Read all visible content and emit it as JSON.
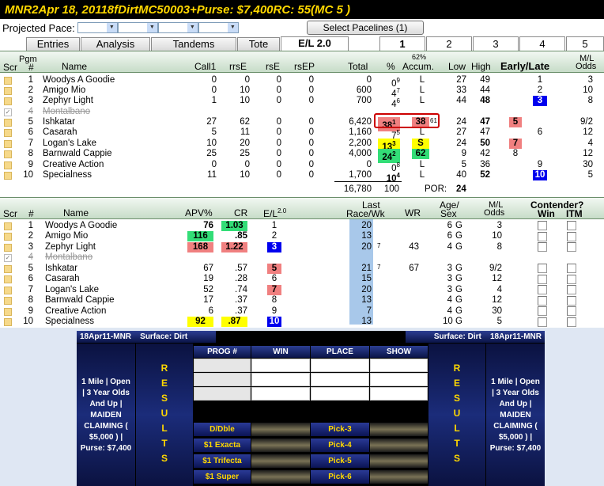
{
  "title": {
    "track": "MNR",
    "race": "2",
    "date": "Apr 18, 2011",
    "distance": "8f",
    "surface": "Dirt",
    "class": "MC5000",
    "age": "3+",
    "purse": "Purse: $7,400",
    "rc": "RC: 55",
    "mc": "(MC 5 )"
  },
  "pace": {
    "label": "Projected Pace:",
    "button": "Select Pacelines  (1)"
  },
  "tabs": [
    "Entries",
    "Analysis",
    "Tandems",
    "Tote",
    "E/L 2.0"
  ],
  "rtabs": [
    "1",
    "2",
    "3",
    "4",
    "5"
  ],
  "top_header": {
    "scr": "Scr",
    "pgm": "Pgm",
    "pgm_hash": "#",
    "name": "Name",
    "call1": "Call1",
    "rrse": "rrsE",
    "rse": "rsE",
    "rsep": "rsEP",
    "total": "Total",
    "pct": "%",
    "accum_pct": "62%",
    "accum": "Accum.",
    "low": "Low",
    "high": "High",
    "early_late": "Early/Late",
    "ml": "M/L",
    "odds": "Odds"
  },
  "top_rows": [
    {
      "num": "1",
      "name": "Woodys A Goodie",
      "call1": "0",
      "rrse": "0",
      "rse": "0",
      "rsep": "0",
      "total": "0",
      "pct": "0",
      "pct_sup": "9",
      "accum": "L",
      "low": "27",
      "high": "49",
      "early": "",
      "late": "1",
      "ml": "3"
    },
    {
      "num": "2",
      "name": "Amigo Mio",
      "call1": "0",
      "rrse": "10",
      "rse": "0",
      "rsep": "0",
      "total": "600",
      "pct": "4",
      "pct_sup": "7",
      "accum": "L",
      "low": "33",
      "high": "44",
      "early": "",
      "late": "2",
      "ml": "10"
    },
    {
      "num": "3",
      "name": "Zephyr Light",
      "call1": "1",
      "rrse": "10",
      "rse": "0",
      "rsep": "0",
      "total": "700",
      "pct": "4",
      "pct_sup": "6",
      "accum": "L",
      "low": "44",
      "high": "48",
      "early": "",
      "late": "3",
      "ml": "8"
    },
    {
      "num": "4",
      "name": "Montalbano",
      "scratched": true
    },
    {
      "num": "5",
      "name": "Ishkatar",
      "call1": "27",
      "rrse": "62",
      "rse": "0",
      "rsep": "0",
      "total": "6,420",
      "pct": "38",
      "pct_sup": "1",
      "accum": "38",
      "accum_sup": "61",
      "low": "24",
      "high": "47",
      "early": "5",
      "late": "",
      "ml": "9/2"
    },
    {
      "num": "6",
      "name": "Casarah",
      "call1": "5",
      "rrse": "11",
      "rse": "0",
      "rsep": "0",
      "total": "1,160",
      "pct": "7",
      "pct_sup": "5",
      "accum": "L",
      "low": "27",
      "high": "47",
      "early": "",
      "late": "6",
      "ml": "12"
    },
    {
      "num": "7",
      "name": "Logan's Lake",
      "call1": "10",
      "rrse": "20",
      "rse": "0",
      "rsep": "0",
      "total": "2,200",
      "pct": "13",
      "pct_sup": "3",
      "accum": "S",
      "low": "24",
      "high": "50",
      "early": "7",
      "late": "",
      "ml": "4"
    },
    {
      "num": "8",
      "name": "Barnwald Cappie",
      "call1": "25",
      "rrse": "25",
      "rse": "0",
      "rsep": "0",
      "total": "4,000",
      "pct": "24",
      "pct_sup": "2",
      "accum": "62",
      "low": "9",
      "high": "42",
      "early": "8",
      "late": "",
      "ml": "12"
    },
    {
      "num": "9",
      "name": "Creative Action",
      "call1": "0",
      "rrse": "0",
      "rse": "0",
      "rsep": "0",
      "total": "0",
      "pct": "0",
      "pct_sup": "8",
      "accum": "L",
      "low": "5",
      "high": "36",
      "early": "",
      "late": "9",
      "ml": "30"
    },
    {
      "num": "10",
      "name": "Specialness",
      "call1": "11",
      "rrse": "10",
      "rse": "0",
      "rsep": "0",
      "total": "1,700",
      "pct": "10",
      "pct_sup": "4",
      "accum": "L",
      "low": "40",
      "high": "52",
      "early": "",
      "late": "10",
      "ml": "5"
    }
  ],
  "top_totals": {
    "total": "16,780",
    "pct": "100",
    "por_label": "POR:",
    "por": "24"
  },
  "mid_header": {
    "scr": "Scr",
    "hash": "#",
    "name": "Name",
    "apv": "APV%",
    "cr": "CR",
    "el": "E/L",
    "el_sup": "2.0",
    "last": "Last",
    "race_wk": "Race/Wk",
    "wr": "WR",
    "age": "Age/",
    "sex": "Sex",
    "ml": "M/L",
    "odds": "Odds",
    "contender": "Contender?",
    "win": "Win",
    "itm": "ITM"
  },
  "mid_rows": [
    {
      "num": "1",
      "name": "Woodys A Goodie",
      "apv": "76",
      "cr": "1.03",
      "el": "1",
      "last": "20",
      "last_sup": "",
      "wr": "",
      "age": "6",
      "sex": "G",
      "ml": "3"
    },
    {
      "num": "2",
      "name": "Amigo Mio",
      "apv": "116",
      "cr": ".85",
      "el": "2",
      "last": "13",
      "last_sup": "",
      "wr": "",
      "age": "6",
      "sex": "G",
      "ml": "10"
    },
    {
      "num": "3",
      "name": "Zephyr Light",
      "apv": "168",
      "cr": "1.22",
      "el": "3",
      "last": "20",
      "last_sup": "7",
      "wr": "43",
      "age": "4",
      "sex": "G",
      "ml": "8"
    },
    {
      "num": "4",
      "name": "Montalbano",
      "scratched": true
    },
    {
      "num": "5",
      "name": "Ishkatar",
      "apv": "67",
      "cr": ".57",
      "el": "5",
      "last": "21",
      "last_sup": "7",
      "wr": "67",
      "age": "3",
      "sex": "G",
      "ml": "9/2"
    },
    {
      "num": "6",
      "name": "Casarah",
      "apv": "19",
      "cr": ".28",
      "el": "6",
      "last": "15",
      "last_sup": "",
      "wr": "",
      "age": "3",
      "sex": "G",
      "ml": "12"
    },
    {
      "num": "7",
      "name": "Logan's Lake",
      "apv": "52",
      "cr": ".74",
      "el": "7",
      "last": "20",
      "last_sup": "",
      "wr": "",
      "age": "3",
      "sex": "G",
      "ml": "4"
    },
    {
      "num": "8",
      "name": "Barnwald Cappie",
      "apv": "17",
      "cr": ".37",
      "el": "8",
      "last": "13",
      "last_sup": "",
      "wr": "",
      "age": "4",
      "sex": "G",
      "ml": "12"
    },
    {
      "num": "9",
      "name": "Creative Action",
      "apv": "6",
      "cr": ".37",
      "el": "9",
      "last": "7",
      "last_sup": "",
      "wr": "",
      "age": "4",
      "sex": "G",
      "ml": "30"
    },
    {
      "num": "10",
      "name": "Specialness",
      "apv": "92",
      "cr": ".87",
      "el": "10",
      "last": "13",
      "last_sup": "",
      "wr": "",
      "age": "10",
      "sex": "G",
      "ml": "5"
    }
  ],
  "results": {
    "hdr_left": "18Apr11-MNR",
    "surface_left": "Surface: Dirt",
    "surface_right": "Surface: Dirt",
    "hdr_right": "18Apr11-MNR",
    "desc_lines": [
      "1 Mile | Open",
      "| 3 Year Olds",
      "And Up |",
      "MAIDEN",
      "CLAIMING (",
      "$5,000 ) |",
      "Purse: $7,400"
    ],
    "vert": [
      "R",
      "E",
      "S",
      "U",
      "L",
      "T",
      "S"
    ],
    "cols": [
      "PROG #",
      "WIN",
      "PLACE",
      "SHOW"
    ],
    "exotics_left": [
      "D/Dble",
      "$1 Exacta",
      "$1 Trifecta",
      "$1 Super"
    ],
    "exotics_right": [
      "Pick-3",
      "Pick-4",
      "Pick-5",
      "Pick-6"
    ]
  },
  "colors": {
    "title_bg": "#000000",
    "title_fg": "#ffd800",
    "high_red": "#f08080",
    "high_yellow": "#ffff00",
    "high_green": "#33dd77",
    "high_blue": "#0000ee"
  }
}
